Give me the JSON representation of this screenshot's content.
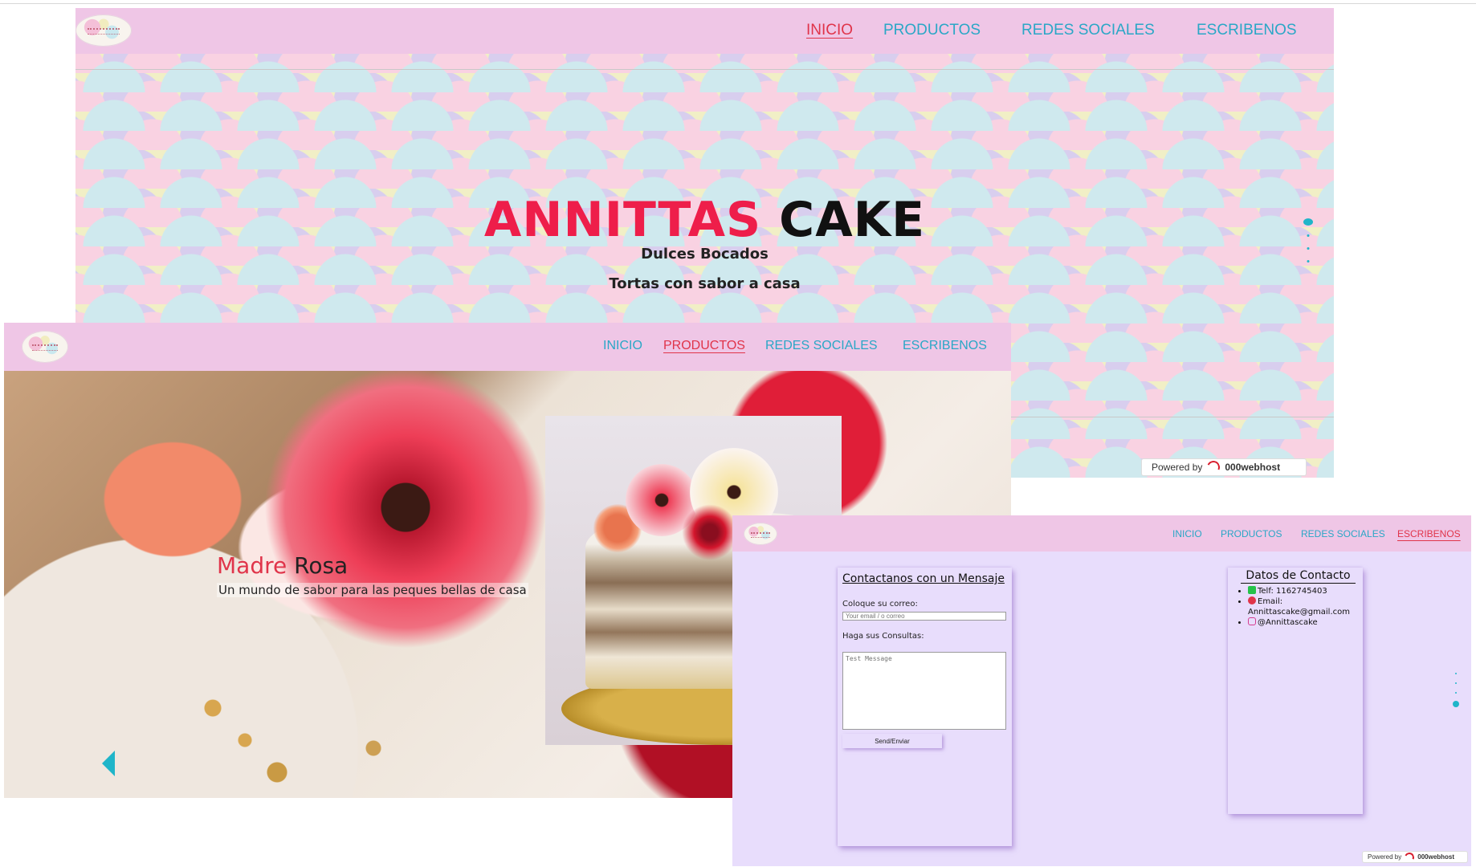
{
  "nav": {
    "inicio": "INICIO",
    "productos": "PRODUCTOS",
    "redes": "REDES SOCIALES",
    "escribenos": "ESCRIBENOS"
  },
  "screen1": {
    "title_part1": "ANNITTAS",
    "title_part2": "CAKE",
    "subtitle1": "Dulces Bocados",
    "subtitle2": "Tortas con sabor a casa",
    "powered_by": "Powered by",
    "host_brand": "000webhost"
  },
  "screen2": {
    "slide_title_part1": "Madre",
    "slide_title_part2": "Rosa",
    "slide_subtitle": "Un mundo de sabor para las peques bellas de casa"
  },
  "screen3": {
    "form_title": "Contactanos con un Mensaje",
    "email_label": "Coloque su correo:",
    "email_placeholder": "Your email / o correo",
    "message_label": "Haga sus Consultas:",
    "message_placeholder": "Test Message",
    "send_label": "Send/Enviar",
    "contact_title": "Datos de Contacto",
    "phone": "Telf: 1162745403",
    "email": "Email: Annittascake@gmail.com",
    "instagram": "@Annittascake",
    "powered_by": "Powered by",
    "host_brand": "000webhost"
  },
  "colors": {
    "nav_bg": "#efc6e6",
    "nav_link": "#2aa7c6",
    "nav_active": "#e0344a",
    "title_accent": "#ee1e4a",
    "contact_bg": "#e8ddfc",
    "slider_dot": "#1fb5c9"
  },
  "icons": [
    "logo",
    "phone-icon",
    "email-icon",
    "instagram-icon",
    "webhost-icon",
    "arrow-left-icon"
  ]
}
